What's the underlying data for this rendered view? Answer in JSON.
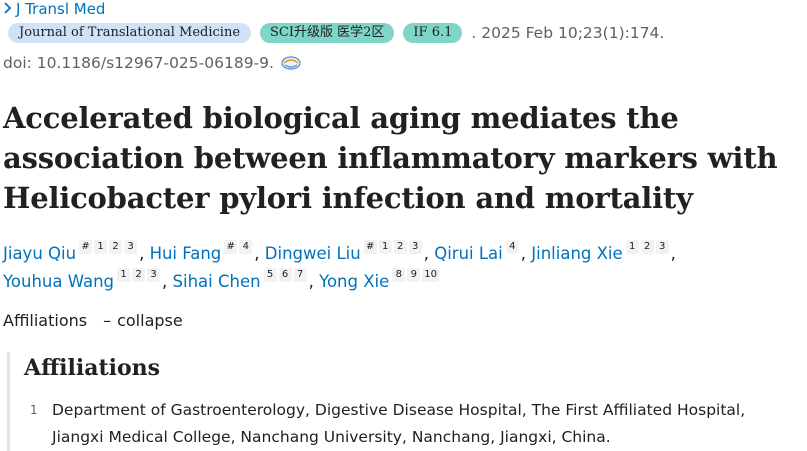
{
  "journal": {
    "chevron_icon": "chevron-right-icon",
    "name": "J Transl Med"
  },
  "badges": {
    "journal_full": "Journal of Translational Medicine",
    "sci_rank": "SCI升级版 医学2区",
    "impact_factor": "IF 6.1"
  },
  "citation": ". 2025 Feb 10;23(1):174.",
  "doi": {
    "text": "doi: 10.1186/s12967-025-06189-9.",
    "icon": "fulltext-link-icon"
  },
  "title": "Accelerated biological aging mediates the association between inflammatory markers with Helicobacter pylori infection and mortality",
  "authors": [
    {
      "name": "Jiayu Qiu",
      "sups": [
        "#",
        "1",
        "2",
        "3"
      ]
    },
    {
      "name": "Hui Fang",
      "sups": [
        "#",
        "4"
      ]
    },
    {
      "name": "Dingwei Liu",
      "sups": [
        "#",
        "1",
        "2",
        "3"
      ]
    },
    {
      "name": "Qirui Lai",
      "sups": [
        "4"
      ]
    },
    {
      "name": "Jinliang Xie",
      "sups": [
        "1",
        "2",
        "3"
      ]
    },
    {
      "name": "Youhua Wang",
      "sups": [
        "1",
        "2",
        "3"
      ]
    },
    {
      "name": "Sihai Chen",
      "sups": [
        "5",
        "6",
        "7"
      ]
    },
    {
      "name": "Yong Xie",
      "sups": [
        "8",
        "9",
        "10"
      ]
    }
  ],
  "affiliations_toggle": {
    "label": "Affiliations",
    "dash": "–",
    "action": "collapse"
  },
  "affiliations": {
    "heading": "Affiliations",
    "items": [
      {
        "num": "1",
        "text": "Department of Gastroenterology, Digestive Disease Hospital, The First Affiliated Hospital, Jiangxi Medical College, Nanchang University, Nanchang, Jiangxi, China."
      }
    ]
  },
  "colors": {
    "link": "#0071bc",
    "badge_blue": "#cfe2f7",
    "badge_green": "#7fd6c6",
    "muted": "#5b616b"
  }
}
